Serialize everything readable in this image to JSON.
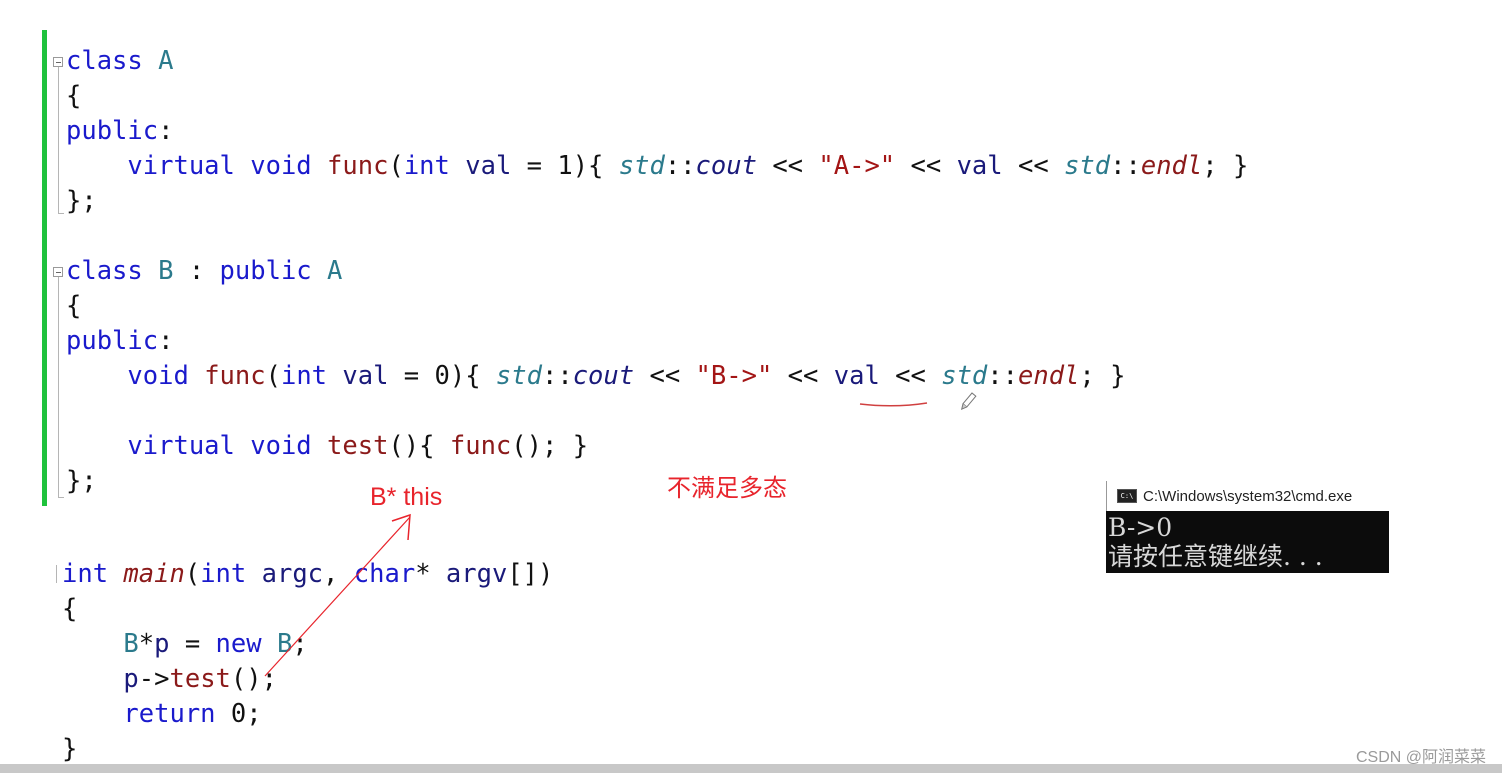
{
  "editor": {
    "lines": [
      {
        "id": "l1",
        "tokens": [
          {
            "t": "class",
            "c": "kw"
          },
          {
            "t": " ",
            "c": "punct"
          },
          {
            "t": "A",
            "c": "type"
          }
        ]
      },
      {
        "id": "l2",
        "tokens": [
          {
            "t": "{",
            "c": "punct"
          }
        ]
      },
      {
        "id": "l3",
        "tokens": [
          {
            "t": "public",
            "c": "kw"
          },
          {
            "t": ":",
            "c": "punct"
          }
        ]
      },
      {
        "id": "l4",
        "tokens": [
          {
            "t": "    virtual",
            "c": "kw"
          },
          {
            "t": " ",
            "c": "punct"
          },
          {
            "t": "void",
            "c": "kw"
          },
          {
            "t": " ",
            "c": "punct"
          },
          {
            "t": "func",
            "c": "fn"
          },
          {
            "t": "(",
            "c": "punct"
          },
          {
            "t": "int",
            "c": "kw"
          },
          {
            "t": " ",
            "c": "punct"
          },
          {
            "t": "val",
            "c": "id"
          },
          {
            "t": " = 1){ ",
            "c": "punct"
          },
          {
            "t": "std",
            "c": "ns"
          },
          {
            "t": "::",
            "c": "punct"
          },
          {
            "t": "cout",
            "c": "ital-id"
          },
          {
            "t": " << ",
            "c": "punct"
          },
          {
            "t": "\"A->\"",
            "c": "str"
          },
          {
            "t": " << ",
            "c": "punct"
          },
          {
            "t": "val",
            "c": "id"
          },
          {
            "t": " << ",
            "c": "punct"
          },
          {
            "t": "std",
            "c": "ns"
          },
          {
            "t": "::",
            "c": "punct"
          },
          {
            "t": "endl",
            "c": "ital-fn"
          },
          {
            "t": "; }",
            "c": "punct"
          }
        ]
      },
      {
        "id": "l5",
        "tokens": [
          {
            "t": "};",
            "c": "punct"
          }
        ]
      },
      {
        "id": "l6",
        "tokens": [
          {
            "t": "class",
            "c": "kw"
          },
          {
            "t": " ",
            "c": "punct"
          },
          {
            "t": "B",
            "c": "type"
          },
          {
            "t": " : ",
            "c": "punct"
          },
          {
            "t": "public",
            "c": "kw"
          },
          {
            "t": " ",
            "c": "punct"
          },
          {
            "t": "A",
            "c": "type"
          }
        ]
      },
      {
        "id": "l7",
        "tokens": [
          {
            "t": "{",
            "c": "punct"
          }
        ]
      },
      {
        "id": "l8",
        "tokens": [
          {
            "t": "public",
            "c": "kw"
          },
          {
            "t": ":",
            "c": "punct"
          }
        ]
      },
      {
        "id": "l9",
        "tokens": [
          {
            "t": "    void",
            "c": "kw"
          },
          {
            "t": " ",
            "c": "punct"
          },
          {
            "t": "func",
            "c": "fn"
          },
          {
            "t": "(",
            "c": "punct"
          },
          {
            "t": "int",
            "c": "kw"
          },
          {
            "t": " ",
            "c": "punct"
          },
          {
            "t": "val",
            "c": "id"
          },
          {
            "t": " = 0){ ",
            "c": "punct"
          },
          {
            "t": "std",
            "c": "ns"
          },
          {
            "t": "::",
            "c": "punct"
          },
          {
            "t": "cout",
            "c": "ital-id"
          },
          {
            "t": " << ",
            "c": "punct"
          },
          {
            "t": "\"B->\"",
            "c": "str"
          },
          {
            "t": " << ",
            "c": "punct"
          },
          {
            "t": "val",
            "c": "id"
          },
          {
            "t": " << ",
            "c": "punct"
          },
          {
            "t": "std",
            "c": "ns"
          },
          {
            "t": "::",
            "c": "punct"
          },
          {
            "t": "endl",
            "c": "ital-fn"
          },
          {
            "t": "; }",
            "c": "punct"
          }
        ]
      },
      {
        "id": "l10",
        "tokens": [
          {
            "t": "    virtual",
            "c": "kw"
          },
          {
            "t": " ",
            "c": "punct"
          },
          {
            "t": "void",
            "c": "kw"
          },
          {
            "t": " ",
            "c": "punct"
          },
          {
            "t": "test",
            "c": "fn"
          },
          {
            "t": "(){ ",
            "c": "punct"
          },
          {
            "t": "func",
            "c": "fn"
          },
          {
            "t": "(); }",
            "c": "punct"
          }
        ]
      },
      {
        "id": "l11",
        "tokens": [
          {
            "t": "};",
            "c": "punct"
          }
        ]
      },
      {
        "id": "l12",
        "tokens": [
          {
            "t": "int",
            "c": "kw"
          },
          {
            "t": " ",
            "c": "punct"
          },
          {
            "t": "main",
            "c": "ital-fn"
          },
          {
            "t": "(",
            "c": "punct"
          },
          {
            "t": "int",
            "c": "kw"
          },
          {
            "t": " ",
            "c": "punct"
          },
          {
            "t": "argc",
            "c": "id"
          },
          {
            "t": ", ",
            "c": "punct"
          },
          {
            "t": "char",
            "c": "kw"
          },
          {
            "t": "* ",
            "c": "punct"
          },
          {
            "t": "argv",
            "c": "id"
          },
          {
            "t": "[])",
            "c": "punct"
          }
        ]
      },
      {
        "id": "l13",
        "tokens": [
          {
            "t": "{",
            "c": "punct"
          }
        ]
      },
      {
        "id": "l14",
        "tokens": [
          {
            "t": "    B",
            "c": "type"
          },
          {
            "t": "*",
            "c": "punct"
          },
          {
            "t": "p",
            "c": "id"
          },
          {
            "t": " = ",
            "c": "punct"
          },
          {
            "t": "new",
            "c": "kw"
          },
          {
            "t": " ",
            "c": "punct"
          },
          {
            "t": "B",
            "c": "type"
          },
          {
            "t": ";",
            "c": "punct"
          }
        ]
      },
      {
        "id": "l15",
        "tokens": [
          {
            "t": "    p",
            "c": "id"
          },
          {
            "t": "->",
            "c": "punct"
          },
          {
            "t": "test",
            "c": "fn"
          },
          {
            "t": "();",
            "c": "punct"
          }
        ]
      },
      {
        "id": "l16",
        "tokens": [
          {
            "t": "    return",
            "c": "kw"
          },
          {
            "t": " 0;",
            "c": "punct"
          }
        ]
      },
      {
        "id": "l17",
        "tokens": [
          {
            "t": "}",
            "c": "punct"
          }
        ]
      }
    ]
  },
  "annotations": {
    "this_label": "B* this",
    "polymorphism_note": "不满足多态"
  },
  "console": {
    "title": "C:\\Windows\\system32\\cmd.exe",
    "icon": "cmd-icon",
    "icon_text": "C:\\",
    "output_lines": [
      "B->0",
      "请按任意键继续. . ."
    ]
  },
  "footer": {
    "watermark": "CSDN @阿润菜菜"
  },
  "colors": {
    "keyword": "#1a1acc",
    "type": "#2b7a8c",
    "function": "#8b1a1a",
    "string": "#a31515",
    "annotation": "#e8242c",
    "change_bar": "#1fc23c"
  }
}
